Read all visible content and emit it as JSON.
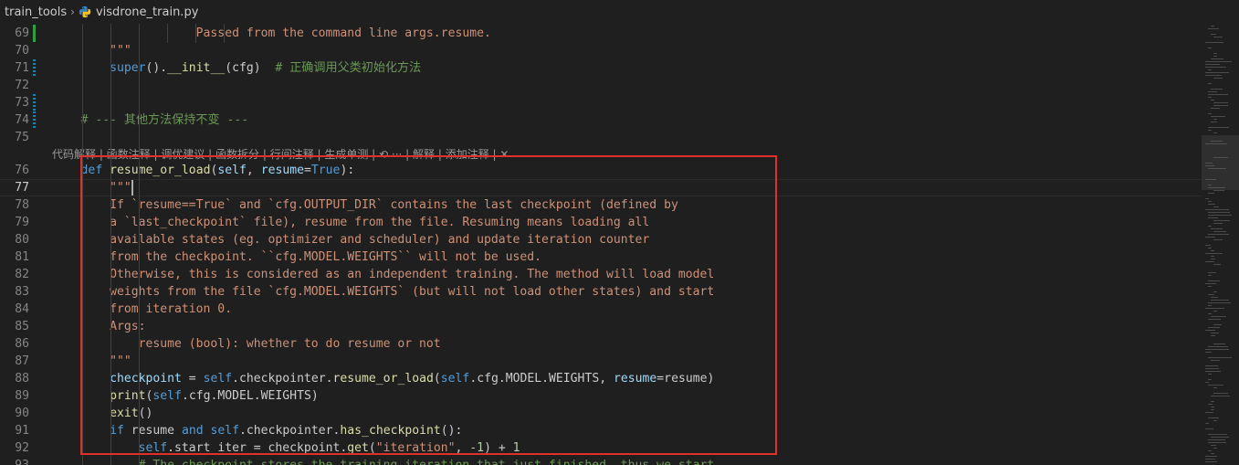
{
  "breadcrumb": {
    "folder": "train_tools",
    "file": "visdrone_train.py"
  },
  "icons": {
    "separator": "chevron-right-icon",
    "file": "python-file-icon"
  },
  "codelens": "代码解释 | 函数注释 | 调优建议 | 函数拆分 | 行间注释 | 生成单测 | ⟲ ··· | 解释 | 添加注释 | ✕",
  "lines": [
    {
      "n": "69",
      "segments": [
        {
          "c": "str",
          "t": "                    Passed from the command line args.resume."
        }
      ]
    },
    {
      "n": "70",
      "segments": [
        {
          "c": "str",
          "t": "        \"\"\""
        }
      ]
    },
    {
      "n": "71",
      "segments": [
        {
          "c": "",
          "t": "        "
        },
        {
          "c": "cl",
          "t": "super"
        },
        {
          "c": "",
          "t": "()."
        },
        {
          "c": "fn",
          "t": "__init__"
        },
        {
          "c": "",
          "t": "(cfg)  "
        },
        {
          "c": "cm",
          "t": "# 正确调用父类初始化方法"
        }
      ]
    },
    {
      "n": "72",
      "segments": []
    },
    {
      "n": "73",
      "segments": []
    },
    {
      "n": "74",
      "segments": [
        {
          "c": "",
          "t": "    "
        },
        {
          "c": "cm",
          "t": "# --- 其他方法保持不变 ---"
        }
      ]
    },
    {
      "n": "75",
      "segments": []
    },
    {
      "n": "76",
      "segments": [
        {
          "c": "",
          "t": "    "
        },
        {
          "c": "kw",
          "t": "def"
        },
        {
          "c": "",
          "t": " "
        },
        {
          "c": "fn",
          "t": "resume_or_load"
        },
        {
          "c": "",
          "t": "("
        },
        {
          "c": "pr",
          "t": "self"
        },
        {
          "c": "",
          "t": ", "
        },
        {
          "c": "pr",
          "t": "resume"
        },
        {
          "c": "",
          "t": "="
        },
        {
          "c": "kw",
          "t": "True"
        },
        {
          "c": "",
          "t": "):"
        }
      ]
    },
    {
      "n": "77",
      "segments": [
        {
          "c": "str",
          "t": "        \"\"\""
        }
      ]
    },
    {
      "n": "78",
      "segments": [
        {
          "c": "str",
          "t": "        If `resume==True` and `cfg.OUTPUT_DIR` contains the last checkpoint (defined by"
        }
      ]
    },
    {
      "n": "79",
      "segments": [
        {
          "c": "str",
          "t": "        a `last_checkpoint` file), resume from the file. Resuming means loading all"
        }
      ]
    },
    {
      "n": "80",
      "segments": [
        {
          "c": "str",
          "t": "        available states (eg. optimizer and scheduler) and update iteration counter"
        }
      ]
    },
    {
      "n": "81",
      "segments": [
        {
          "c": "str",
          "t": "        from the checkpoint. ``cfg.MODEL.WEIGHTS`` will not be used."
        }
      ]
    },
    {
      "n": "82",
      "segments": [
        {
          "c": "str",
          "t": "        Otherwise, this is considered as an independent training. The method will load model"
        }
      ]
    },
    {
      "n": "83",
      "segments": [
        {
          "c": "str",
          "t": "        weights from the file `cfg.MODEL.WEIGHTS` (but will not load other states) and start"
        }
      ]
    },
    {
      "n": "84",
      "segments": [
        {
          "c": "str",
          "t": "        from iteration 0."
        }
      ]
    },
    {
      "n": "85",
      "segments": [
        {
          "c": "str",
          "t": "        Args:"
        }
      ]
    },
    {
      "n": "86",
      "segments": [
        {
          "c": "str",
          "t": "            resume (bool): whether to do resume or not"
        }
      ]
    },
    {
      "n": "87",
      "segments": [
        {
          "c": "str",
          "t": "        \"\"\""
        }
      ]
    },
    {
      "n": "88",
      "segments": [
        {
          "c": "",
          "t": "        "
        },
        {
          "c": "pr",
          "t": "checkpoint"
        },
        {
          "c": "",
          "t": " = "
        },
        {
          "c": "kw",
          "t": "self"
        },
        {
          "c": "",
          "t": ".checkpointer."
        },
        {
          "c": "fn",
          "t": "resume_or_load"
        },
        {
          "c": "",
          "t": "("
        },
        {
          "c": "kw",
          "t": "self"
        },
        {
          "c": "",
          "t": ".cfg.MODEL.WEIGHTS, "
        },
        {
          "c": "pr",
          "t": "resume"
        },
        {
          "c": "",
          "t": "=resume)"
        }
      ]
    },
    {
      "n": "89",
      "segments": [
        {
          "c": "",
          "t": "        "
        },
        {
          "c": "fn",
          "t": "print"
        },
        {
          "c": "",
          "t": "("
        },
        {
          "c": "kw",
          "t": "self"
        },
        {
          "c": "",
          "t": ".cfg.MODEL.WEIGHTS)"
        }
      ]
    },
    {
      "n": "90",
      "segments": [
        {
          "c": "",
          "t": "        "
        },
        {
          "c": "fn",
          "t": "exit"
        },
        {
          "c": "",
          "t": "()"
        }
      ]
    },
    {
      "n": "91",
      "segments": [
        {
          "c": "",
          "t": "        "
        },
        {
          "c": "kw",
          "t": "if"
        },
        {
          "c": "",
          "t": " resume "
        },
        {
          "c": "kw",
          "t": "and"
        },
        {
          "c": "",
          "t": " "
        },
        {
          "c": "kw",
          "t": "self"
        },
        {
          "c": "",
          "t": ".checkpointer."
        },
        {
          "c": "fn",
          "t": "has_checkpoint"
        },
        {
          "c": "",
          "t": "():"
        }
      ]
    },
    {
      "n": "92",
      "segments": [
        {
          "c": "",
          "t": "            "
        },
        {
          "c": "kw",
          "t": "self"
        },
        {
          "c": "",
          "t": ".start_iter = checkpoint."
        },
        {
          "c": "fn",
          "t": "get"
        },
        {
          "c": "",
          "t": "("
        },
        {
          "c": "str",
          "t": "\"iteration\""
        },
        {
          "c": "",
          "t": ", "
        },
        {
          "c": "num",
          "t": "-1"
        },
        {
          "c": "",
          "t": ") + "
        },
        {
          "c": "num",
          "t": "1"
        }
      ]
    },
    {
      "n": "93",
      "segments": [
        {
          "c": "cm",
          "t": "            # The checkpoint stores the training iteration that just finished, thus we start"
        }
      ]
    }
  ],
  "active_line": "77",
  "added_lines": [
    "69"
  ],
  "modified_lines": [
    "71",
    "73",
    "74"
  ],
  "colors": {
    "highlight_box": "#e0302a",
    "background": "#1f1f1f"
  }
}
